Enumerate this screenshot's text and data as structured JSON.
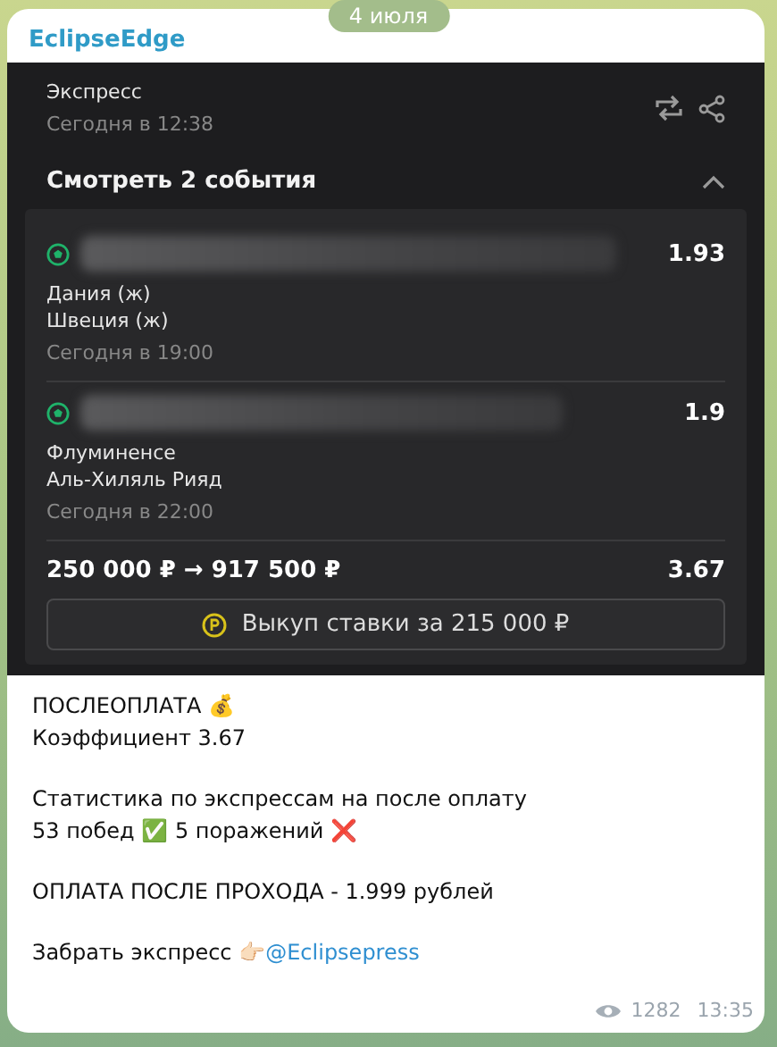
{
  "date_pill": "4 июля",
  "channel_name": "EclipseEdge",
  "bet": {
    "type": "Экспресс",
    "time": "Сегодня в 12:38",
    "toggle": "Смотреть 2 события",
    "expanded": true,
    "events": [
      {
        "team_a": "Дания (ж)",
        "team_b": "Швеция (ж)",
        "time": "Сегодня в 19:00",
        "odds": "1.93"
      },
      {
        "team_a": "Флуминенсе",
        "team_b": "Аль-Хиляль Рияд",
        "time": "Сегодня в 22:00",
        "odds": "1.9"
      }
    ],
    "stake": "250 000 ₽",
    "arrow": "→",
    "payout": "917 500 ₽",
    "total_odds": "3.67",
    "cashout": "Выкуп ставки за 215 000 ₽"
  },
  "message": {
    "paragraphs": [
      [
        "ПОСЛЕОПЛАТА 💰",
        "Коэффициент 3.67"
      ],
      [
        "Статистика по экспрессам на после оплату",
        "53 побед ✅ 5 поражений ❌"
      ],
      [
        "ОПЛАТА ПОСЛЕ ПРОХОДА - 1.999 рублей"
      ]
    ],
    "cta": {
      "text": "Забрать экспресс 👉🏻",
      "link": "@Eclipsepress"
    }
  },
  "views": "1282",
  "time": "13:35"
}
